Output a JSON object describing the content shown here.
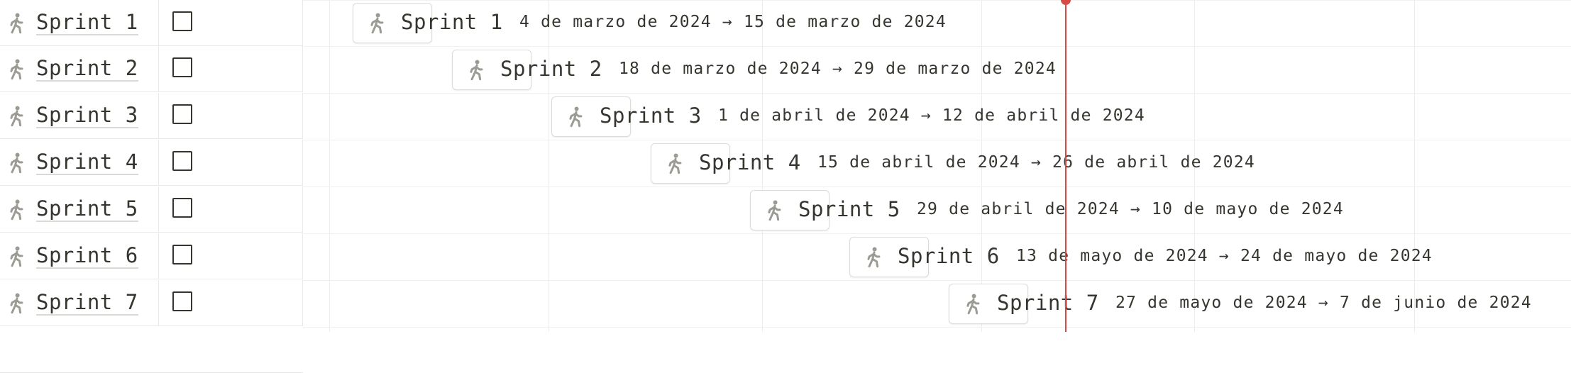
{
  "colors": {
    "icon": "#9b9a93",
    "today_line": "#d44c47",
    "grid": "#ededeb",
    "text": "#37352f"
  },
  "rows": [
    {
      "name": "Sprint 1",
      "icon": "walking-person-icon",
      "dates": "4 de marzo de 2024 → 15 de marzo de 2024",
      "done": false
    },
    {
      "name": "Sprint 2",
      "icon": "walking-person-icon",
      "dates": "18 de marzo de 2024 → 29 de marzo de 2024",
      "done": false
    },
    {
      "name": "Sprint 3",
      "icon": "walking-person-icon",
      "dates": "1 de abril de 2024 → 12 de abril de 2024",
      "done": false
    },
    {
      "name": "Sprint 4",
      "icon": "walking-person-icon",
      "dates": "15 de abril de 2024 → 26 de abril de 2024",
      "done": false
    },
    {
      "name": "Sprint 5",
      "icon": "walking-person-icon",
      "dates": "29 de abril de 2024 → 10 de mayo de 2024",
      "done": false
    },
    {
      "name": "Sprint 6",
      "icon": "walking-person-icon",
      "dates": "13 de mayo de 2024 → 24 de mayo de 2024",
      "done": false
    },
    {
      "name": "Sprint 7",
      "icon": "walking-person-icon",
      "dates": "27 de mayo de 2024 → 7 de junio de 2024",
      "done": false
    }
  ]
}
